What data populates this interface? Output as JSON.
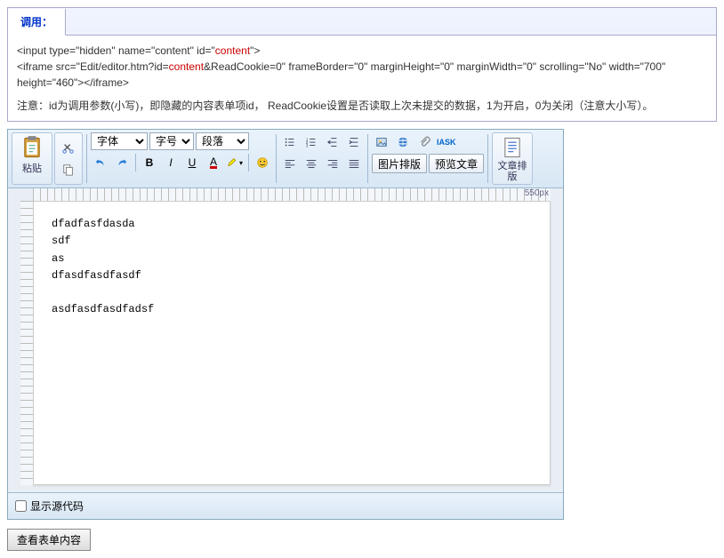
{
  "tab": {
    "label": "调用："
  },
  "code": {
    "line1a": "<input type=\"hidden\" name=\"content\" id=\"",
    "line1b": "content",
    "line1c": "\">",
    "line2a": "<iframe src=\"Edit/editor.htm?id=",
    "line2b": "content",
    "line2c": "&ReadCookie=0\" frameBorder=\"0\" marginHeight=\"0\" marginWidth=\"0\" scrolling=\"No\" width=\"700\" height=\"460\"></iframe>"
  },
  "note": "注意：id为调用参数(小写)，即隐藏的内容表单项id， ReadCookie设置是否读取上次未提交的数据，1为开启，0为关闭（注意大小写）。",
  "toolbar": {
    "paste": "粘贴",
    "font_label": "字体",
    "size_label": "字号",
    "para_label": "段落",
    "pic_layout": "图片排版",
    "preview": "预览文章",
    "article_layout": "文章排版"
  },
  "editor": {
    "width_label": "550px",
    "content": "dfadfasfdasda\nsdf\nas\ndfasdfasdfasdf\n\nasdfasdfasdfadsf"
  },
  "footer": {
    "show_source": "显示源代码"
  },
  "button": {
    "view_form": "查看表单内容"
  }
}
